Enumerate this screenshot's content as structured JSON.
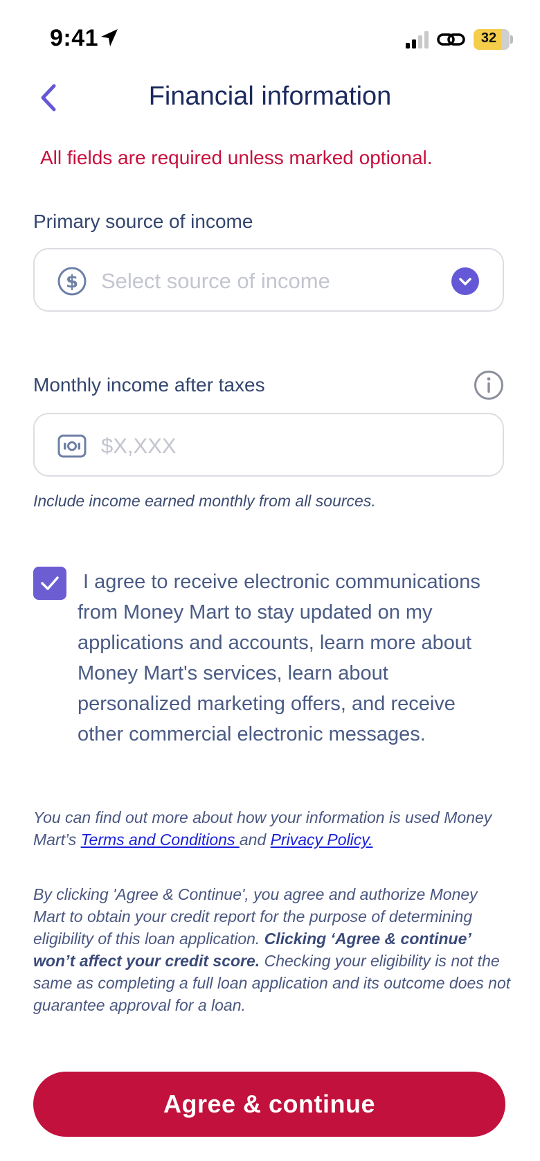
{
  "status_bar": {
    "time": "9:41",
    "battery": "32"
  },
  "header": {
    "title": "Financial information"
  },
  "required_note": "All fields are required unless marked optional.",
  "income_source": {
    "label": "Primary source of income",
    "placeholder": "Select source of income"
  },
  "monthly_income": {
    "label": "Monthly income after taxes",
    "placeholder": "$X,XXX",
    "helper": "Include income earned monthly from all sources."
  },
  "consent": {
    "checked": true,
    "text": "I agree to receive electronic communications from Money Mart to stay updated on my applications and accounts, learn more about Money Mart's services, learn about personalized marketing offers, and receive other commercial electronic messages."
  },
  "legal": {
    "info_prefix": "You can find out more about how your information is used Money Mart’s ",
    "terms_link": "Terms and Conditions ",
    "and": "and ",
    "privacy_link": "Privacy Policy.",
    "authorize_text": "By clicking 'Agree & Continue', you agree and authorize Money Mart to obtain your credit report for the purpose of determining eligibility of this loan application. ",
    "bold_text": "Clicking ‘Agree & continue’ won’t affect your credit score.",
    "after_bold": " Checking your eligibility is not the same as completing a full loan application and its outcome does not guarantee approval for a loan."
  },
  "cta": {
    "label": "Agree & continue"
  },
  "colors": {
    "primary_red": "#c2113d",
    "accent_purple": "#6c5dd3",
    "title_navy": "#1c2a5e",
    "link_blue": "#1b22d8"
  }
}
